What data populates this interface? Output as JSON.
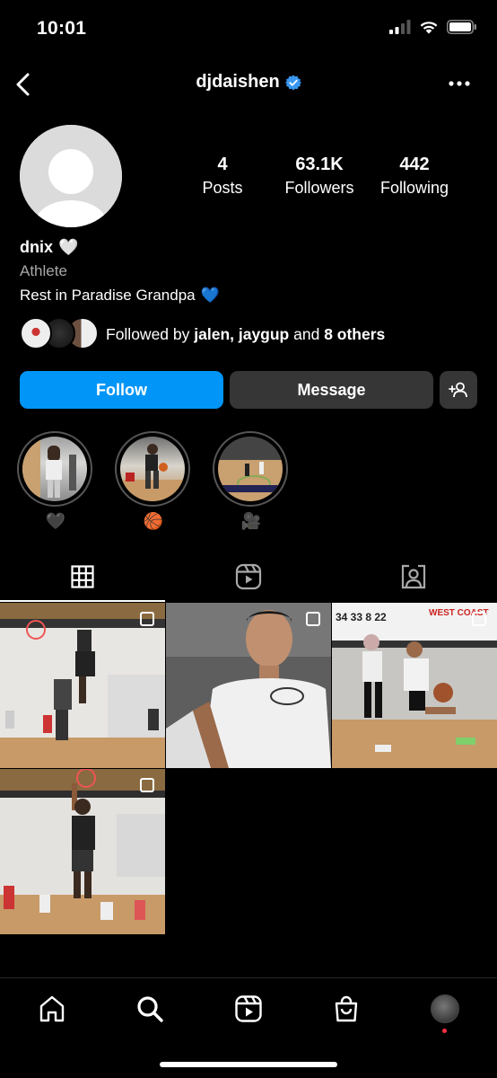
{
  "status_bar": {
    "time": "10:01"
  },
  "header": {
    "username": "djdaishen",
    "verified": true
  },
  "profile": {
    "stats": [
      {
        "number": "4",
        "label": "Posts"
      },
      {
        "number": "63.1K",
        "label": "Followers"
      },
      {
        "number": "442",
        "label": "Following"
      }
    ],
    "name": "dnix",
    "name_emoji": "🤍",
    "category": "Athlete",
    "bio": "Rest in Paradise Grandpa",
    "bio_emoji": "💙",
    "followed_by": {
      "prefix": "Followed by ",
      "users": "jalen, jaygup",
      "middle": " and ",
      "others": "8 others"
    }
  },
  "buttons": {
    "follow": "Follow",
    "message": "Message"
  },
  "highlights": [
    {
      "label": "🖤"
    },
    {
      "label": "🏀"
    },
    {
      "label": "🎥"
    }
  ],
  "tabs": [
    "grid-icon",
    "reels-icon",
    "tagged-icon"
  ],
  "bottom_nav": [
    "home-icon",
    "search-icon",
    "reels-icon",
    "shop-icon",
    "profile-avatar"
  ],
  "colors": {
    "follow_blue": "#0095f6",
    "secondary_button": "#363636",
    "verified_blue": "#3897f0",
    "muted_text": "#a8a8a8"
  }
}
